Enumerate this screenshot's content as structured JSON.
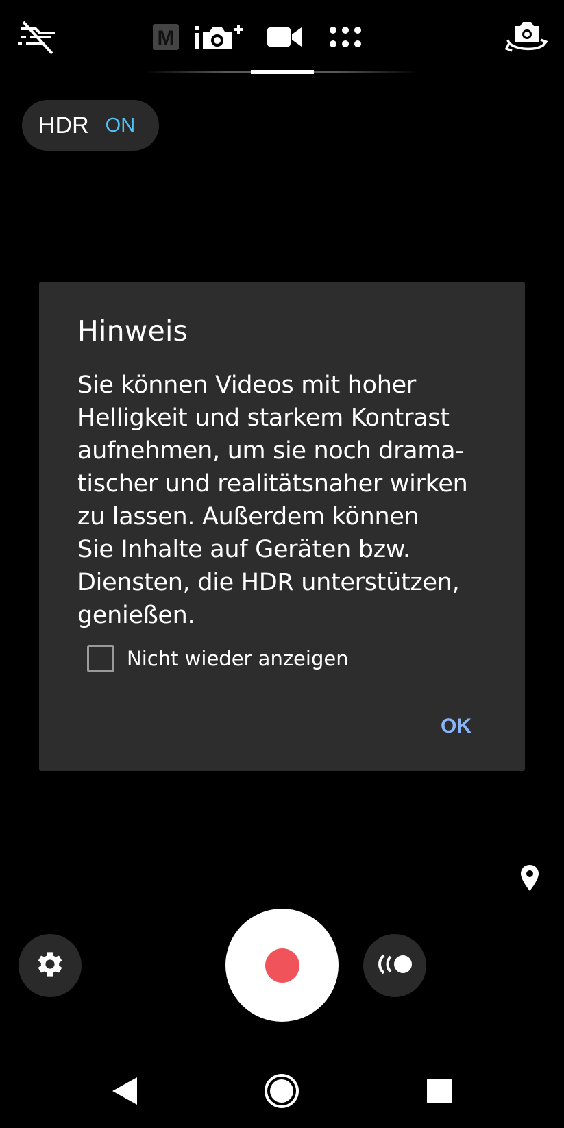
{
  "top_bar": {
    "flash_icon": "flash-off-icon",
    "modes": [
      {
        "name": "manual",
        "label": "M",
        "icon": "manual-mode-icon"
      },
      {
        "name": "photo",
        "icon": "photo-plus-icon"
      },
      {
        "name": "video",
        "icon": "video-camera-icon",
        "selected": true
      },
      {
        "name": "more",
        "icon": "apps-grid-icon"
      }
    ],
    "switch_camera_icon": "switch-camera-icon"
  },
  "hdr": {
    "label": "HDR",
    "state": "ON",
    "state_color": "#4fc3f7"
  },
  "dialog": {
    "title": "Hinweis",
    "body": "Sie können Videos mit hoher Helligkeit und starkem Kontrast aufnehmen, um sie noch dramatischer und realitätsnaher wirken zu lassen. Außerdem können Sie Inhalte auf Geräten bzw. Diensten, die HDR unterstützen, genießen.",
    "body_lines": [
      "Sie können Videos mit hoher",
      "Helligkeit und starkem Kontrast",
      "aufnehmen, um sie noch drama-",
      "tischer und realitätsnaher wirken",
      "zu lassen. Außerdem können",
      "Sie Inhalte auf Geräten bzw.",
      "Diensten, die HDR unterstützen,",
      "genießen."
    ],
    "checkbox_label": "Nicht wieder anzeigen",
    "checkbox_checked": false,
    "ok_label": "OK",
    "ok_color": "#8ab4f8"
  },
  "bottom_controls": {
    "location_icon": "location-pin-icon",
    "settings_icon": "gear-icon",
    "record_icon": "record-dot-icon",
    "record_color": "#f0545a",
    "steadyshot_icon": "steadyshot-icon"
  },
  "nav": {
    "back_icon": "back-triangle-icon",
    "home_icon": "home-circle-icon",
    "recents_icon": "recents-square-icon"
  }
}
